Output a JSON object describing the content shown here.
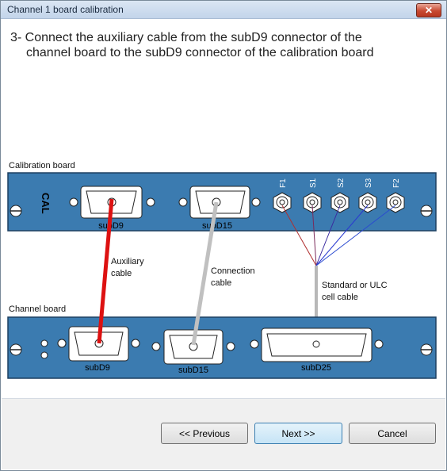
{
  "window": {
    "title": "Channel 1 board calibration",
    "close_glyph": "✕"
  },
  "instruction": {
    "line1": "3- Connect the auxiliary cable from the subD9 connector of the",
    "line2": "channel board to the subD9 connector of the calibration board"
  },
  "diagram": {
    "calibration_board_label": "Calibration board",
    "channel_board_label": "Channel board",
    "cal_logo": "CAL",
    "cal_connectors": [
      "subD9",
      "subD15"
    ],
    "bnc_labels": [
      "F1",
      "S1",
      "S2",
      "S3",
      "F2"
    ],
    "channel_connectors": [
      "subD9",
      "subD15",
      "subD25"
    ],
    "cables": {
      "auxiliary": [
        "Auxiliary",
        "cable"
      ],
      "connection": [
        "Connection",
        "cable"
      ],
      "cell": [
        "Standard or ULC",
        "cell cable"
      ]
    },
    "colors": {
      "board": "#3b7bb0",
      "auxiliary_cable": "#dd1111",
      "connection_cable": "#c0c0c0",
      "cell_cable": "#b8b8b8"
    }
  },
  "buttons": {
    "previous": "<< Previous",
    "next": "Next >>",
    "cancel": "Cancel"
  }
}
